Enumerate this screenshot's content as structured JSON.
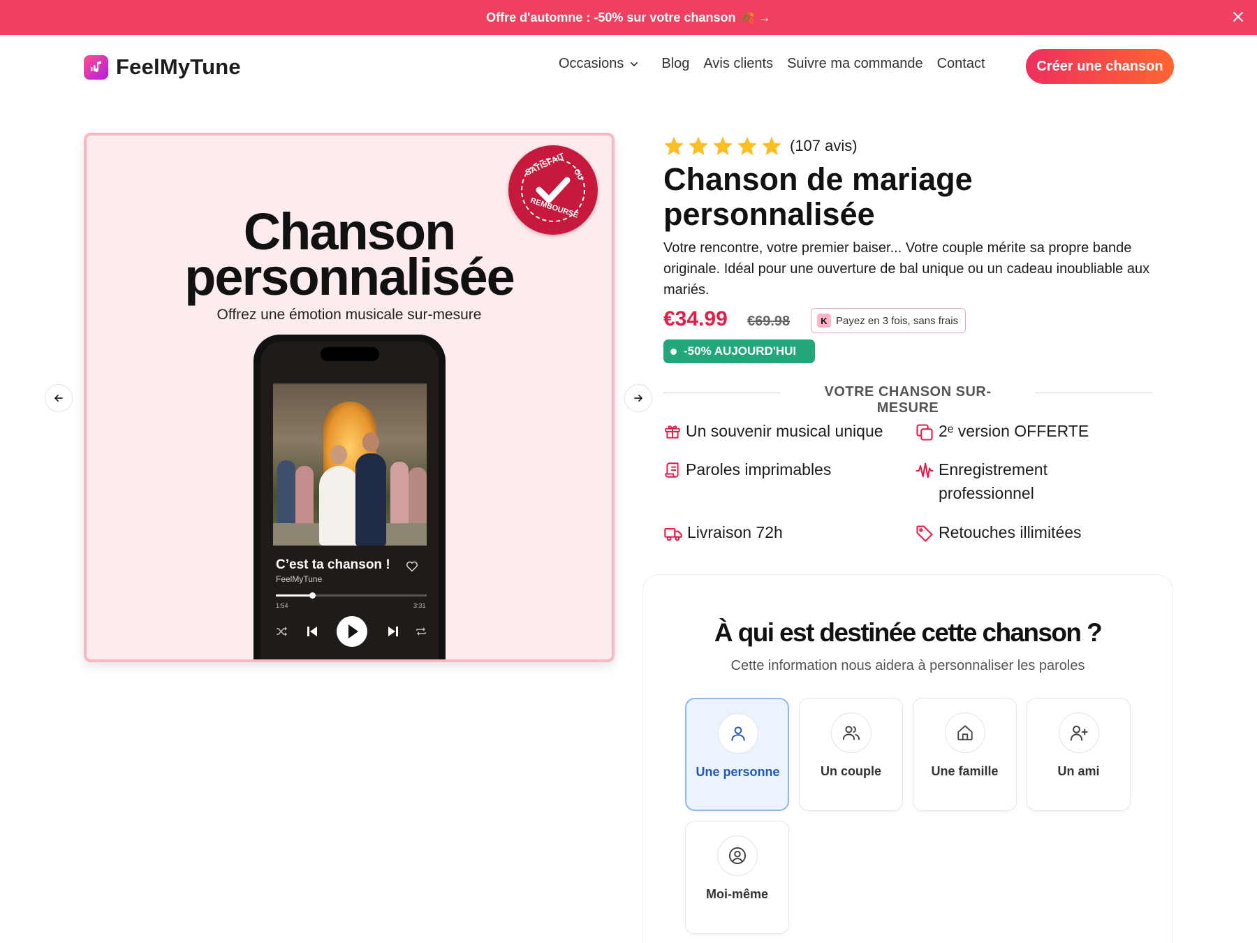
{
  "announcement": {
    "text": "Offre d'automne : -50% sur votre chanson 🍂 →",
    "close_icon": "close-icon"
  },
  "header": {
    "brand": "FeelMyTune",
    "nav": {
      "occasions": "Occasions",
      "blog": "Blog",
      "reviews": "Avis clients",
      "track": "Suivre ma commande",
      "contact": "Contact"
    },
    "cta": "Créer une chanson"
  },
  "gallery": {
    "title_line1": "Chanson",
    "title_line2": "personnalisée",
    "subtitle": "Offrez une émotion musicale sur-mesure",
    "badge": {
      "top": "SATISFAIT",
      "right": "OU",
      "bottom": "REMBOURSÉ"
    },
    "player": {
      "song_title": "C’est ta chanson !",
      "artist": "FeelMyTune",
      "elapsed": "1:54",
      "duration": "3:31",
      "progress": 0.24
    }
  },
  "product": {
    "rating": 5,
    "reviews": "(107 avis)",
    "title": "Chanson de mariage personnalisée",
    "description": "Votre rencontre, votre premier baiser... Votre couple mérite sa propre bande originale. Idéal pour une ouverture de bal unique ou un cadeau inoubliable aux mariés.",
    "price": "€34.99",
    "old_price": "€69.98",
    "klarna_logo": "K",
    "klarna_text": "Payez en 3 fois, sans frais",
    "sale_badge": "-50% AUJOURD'HUI",
    "section_title": "VOTRE CHANSON SUR-MESURE",
    "features": [
      {
        "icon": "gift-icon",
        "label": "Un souvenir musical unique"
      },
      {
        "icon": "copy-icon",
        "label": "2ᵉ version OFFERTE"
      },
      {
        "icon": "scroll-icon",
        "label": "Paroles imprimables"
      },
      {
        "icon": "audio-wave-icon",
        "label": "Enregistrement professionnel"
      },
      {
        "icon": "truck-icon",
        "label": "Livraison 72h"
      },
      {
        "icon": "tag-icon",
        "label": "Retouches illimitées"
      }
    ],
    "colors": {
      "accent": "#e11d48",
      "sale": "#23a779",
      "announce": "#f1405f"
    }
  },
  "recipient": {
    "title": "À qui est destinée cette chanson ?",
    "subtitle": "Cette information nous aidera à personnaliser les paroles",
    "options": [
      {
        "icon": "user-icon",
        "label": "Une personne",
        "selected": true
      },
      {
        "icon": "users-icon",
        "label": "Un couple",
        "selected": false
      },
      {
        "icon": "home-icon",
        "label": "Une famille",
        "selected": false
      },
      {
        "icon": "user-plus-icon",
        "label": "Un ami",
        "selected": false
      },
      {
        "icon": "user-circle-icon",
        "label": "Moi-même",
        "selected": false
      }
    ]
  }
}
